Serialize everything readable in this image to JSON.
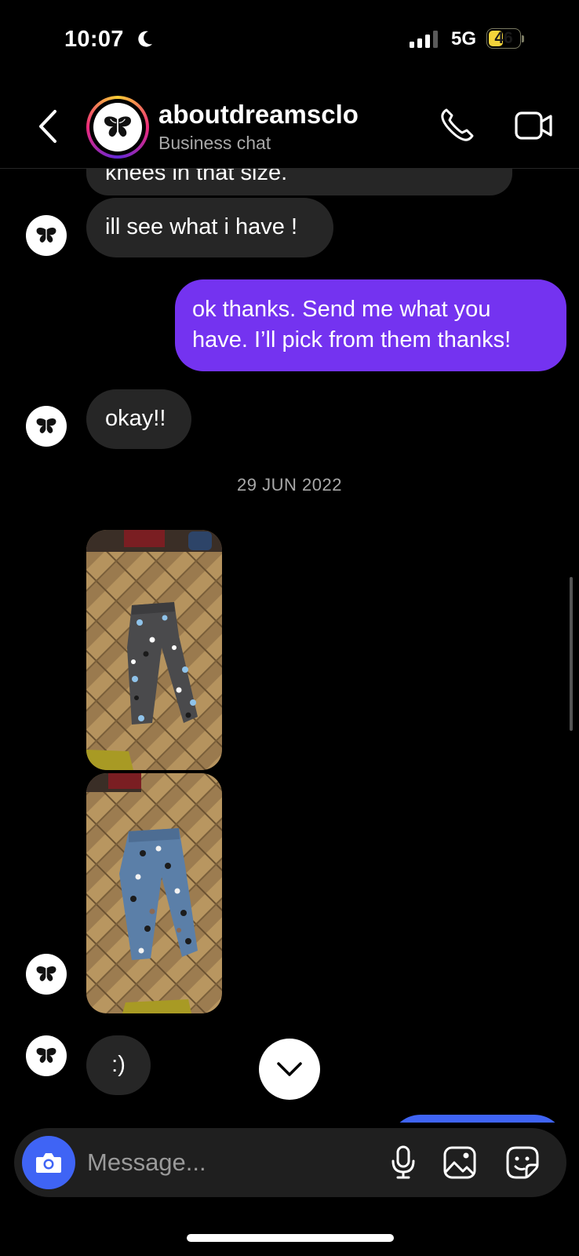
{
  "status_bar": {
    "time": "10:07",
    "network": "5G",
    "battery": "46",
    "battery_level": 0.46
  },
  "header": {
    "contact_name": "aboutdreamsclo",
    "subtitle": "Business chat",
    "avatar_icon": "butterfly-icon"
  },
  "thread": {
    "partial_message_tail": "knees in that size.",
    "messages": [
      {
        "direction": "incoming",
        "text": "ill see what i have !"
      },
      {
        "direction": "outgoing",
        "line1": "ok thanks. Send me what you",
        "line2": "have. I’ll pick from them thanks!"
      },
      {
        "direction": "incoming",
        "text": "okay!!"
      }
    ],
    "date_separator": "29 JUN 2022",
    "photos": [
      {
        "description_icon": "photo-grey-jeans-butterflies"
      },
      {
        "description_icon": "photo-blue-jeans-butterflies"
      }
    ],
    "last_message": ":)"
  },
  "composer": {
    "placeholder": "Message..."
  },
  "colors": {
    "background": "#000000",
    "incoming_bubble": "#262626",
    "outgoing_bubble": "#7433f0",
    "accent_blue": "#3f64f5",
    "battery": "#f4d43a"
  }
}
